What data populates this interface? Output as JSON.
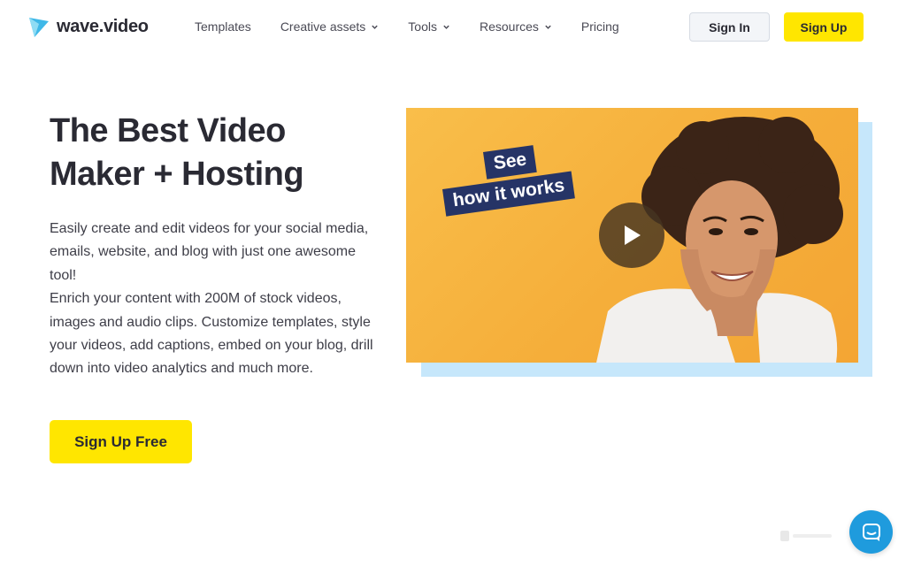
{
  "brand": {
    "name": "wave.video",
    "accent": "#ffe600",
    "logo_color": "#3fb8e8"
  },
  "nav": {
    "items": [
      {
        "label": "Templates",
        "has_dropdown": false
      },
      {
        "label": "Creative assets",
        "has_dropdown": true
      },
      {
        "label": "Tools",
        "has_dropdown": true
      },
      {
        "label": "Resources",
        "has_dropdown": true
      },
      {
        "label": "Pricing",
        "has_dropdown": false
      }
    ],
    "signin_label": "Sign In",
    "signup_label": "Sign Up"
  },
  "hero": {
    "title_line1": "The Best Video",
    "title_line2": "Maker + Hosting",
    "description_1": "Easily create and edit videos for your social media, emails, website, and blog with just one awesome tool!",
    "description_2": "Enrich your content with 200M of stock videos, images and audio clips. Customize templates, style your videos, add captions, embed on your blog, drill down into video analytics and much more.",
    "cta_label": "Sign Up Free"
  },
  "video": {
    "tag_line1": "See",
    "tag_line2": "how it works",
    "play_icon": "play-icon",
    "background_color": "#f7b444",
    "shadow_color": "#c6e7fb"
  },
  "chat": {
    "icon": "chat-icon",
    "color": "#1f9bdd"
  }
}
